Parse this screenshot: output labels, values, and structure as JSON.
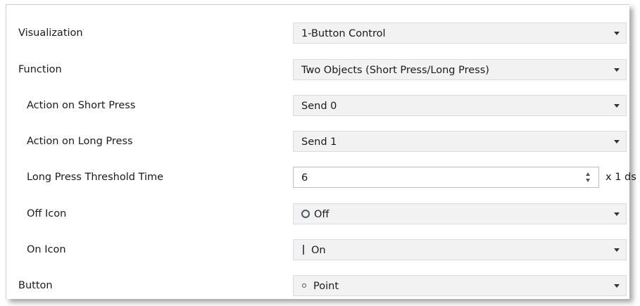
{
  "params": {
    "visualization": {
      "label": "Visualization",
      "value": "1-Button Control"
    },
    "function": {
      "label": "Function",
      "value": "Two Objects (Short Press/Long Press)"
    },
    "short_press": {
      "label": "Action on Short Press",
      "value": "Send 0"
    },
    "long_press": {
      "label": "Action on Long Press",
      "value": "Send 1"
    },
    "threshold": {
      "label": "Long Press Threshold Time",
      "value": "6",
      "unit": "x 1 ds"
    },
    "off_icon": {
      "label": "Off Icon",
      "value": "Off",
      "icon": "ring-icon"
    },
    "on_icon": {
      "label": "On Icon",
      "value": "On",
      "icon": "bar-icon"
    },
    "button": {
      "label": "Button",
      "value": "Point",
      "icon": "point-icon"
    }
  },
  "colors": {
    "field_bg": "#f2f2f2",
    "icon": "#4a5a63"
  }
}
